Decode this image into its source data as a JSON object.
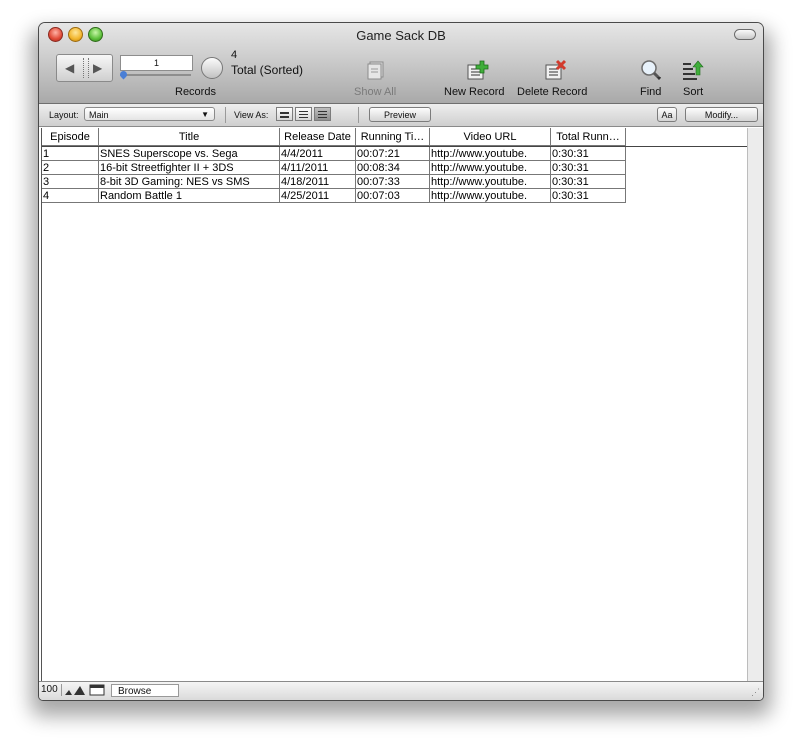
{
  "window": {
    "title": "Game Sack DB"
  },
  "toolbar": {
    "record_value": "1",
    "record_count": "4",
    "record_total": "Total (Sorted)",
    "records_label": "Records",
    "show_all_label": "Show All",
    "new_record_label": "New Record",
    "delete_record_label": "Delete Record",
    "find_label": "Find",
    "sort_label": "Sort"
  },
  "nav": {
    "layout_label": "Layout:",
    "layout_value": "Main",
    "view_as_label": "View As:",
    "preview_label": "Preview",
    "aa_label": "Aa",
    "modify_label": "Modify..."
  },
  "table": {
    "columns": [
      "Episode",
      "Title",
      "Release Date",
      "Running Ti…",
      "Video URL",
      "Total Runn…"
    ],
    "rows": [
      [
        "1",
        "SNES Superscope vs. Sega",
        "4/4/2011",
        "00:07:21",
        "http://www.youtube.",
        "0:30:31"
      ],
      [
        "2",
        "16-bit Streetfighter II + 3DS",
        "4/11/2011",
        "00:08:34",
        "http://www.youtube.",
        "0:30:31"
      ],
      [
        "3",
        "8-bit 3D Gaming: NES vs SMS",
        "4/18/2011",
        "00:07:33",
        "http://www.youtube.",
        "0:30:31"
      ],
      [
        "4",
        "Random Battle 1",
        "4/25/2011",
        "00:07:03",
        "http://www.youtube.",
        "0:30:31"
      ]
    ]
  },
  "status": {
    "zoom": "100",
    "mode": "Browse"
  },
  "colors": {
    "accent": "#4a7fd6",
    "toolbar_top": "#e6e6e6",
    "toolbar_bottom": "#a9a9a9"
  }
}
